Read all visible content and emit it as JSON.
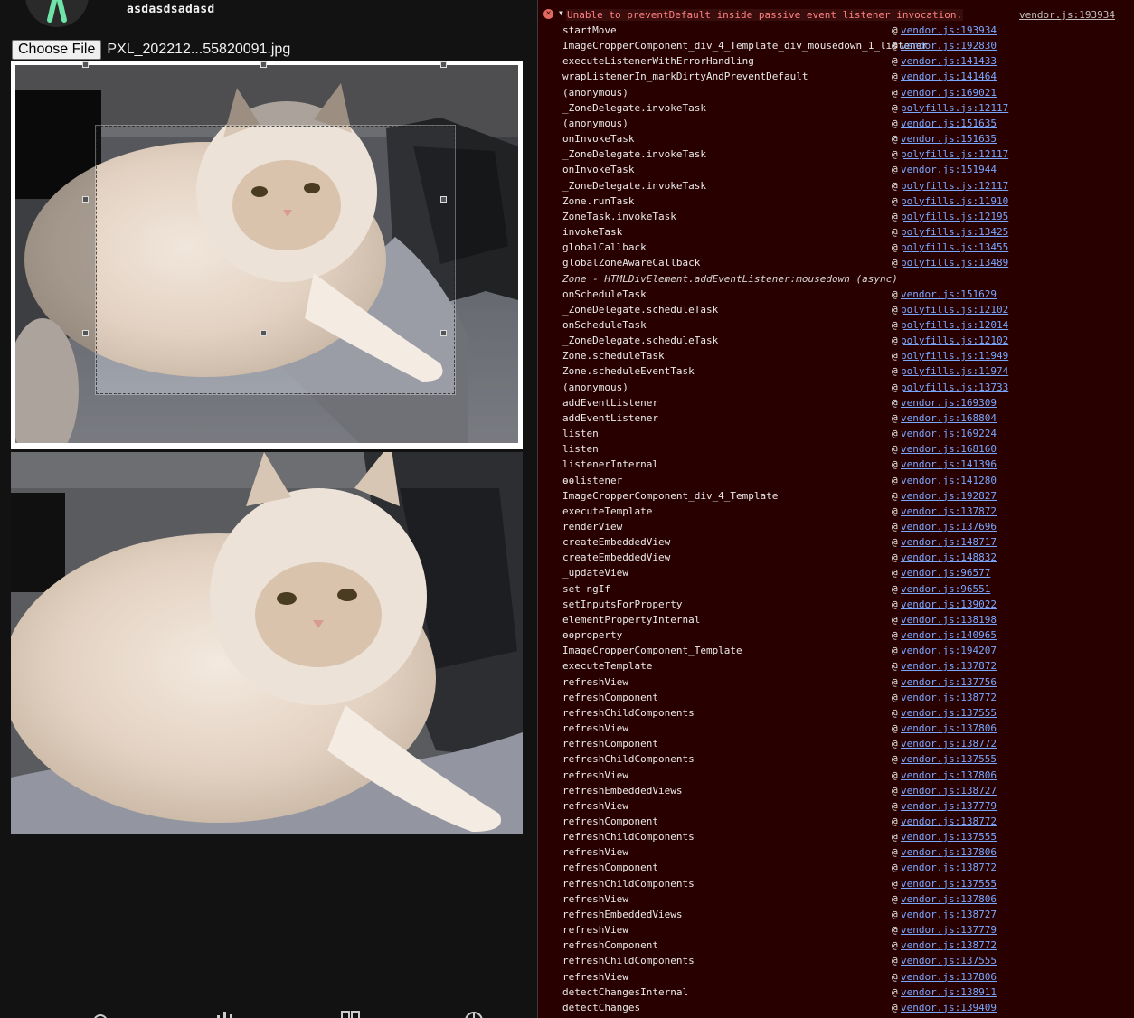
{
  "app": {
    "username": "asdasdsadasd",
    "file_input": {
      "button_label": "Choose File",
      "file_name": "PXL_202212...55820091.jpg"
    },
    "icons": [
      "avatar-logo-icon",
      "menu-icon",
      "search-icon",
      "chart-icon",
      "grid-icon",
      "globe-icon"
    ]
  },
  "console": {
    "error": {
      "message": "Unable to preventDefault inside passive event listener invocation.",
      "source": "vendor.js:193934"
    },
    "stack": [
      {
        "fn": "startMove",
        "loc": "vendor.js:193934"
      },
      {
        "fn": "ImageCropperComponent_div_4_Template_div_mousedown_1_listener",
        "loc": "vendor.js:192830"
      },
      {
        "fn": "executeListenerWithErrorHandling",
        "loc": "vendor.js:141433"
      },
      {
        "fn": "wrapListenerIn_markDirtyAndPreventDefault",
        "loc": "vendor.js:141464"
      },
      {
        "fn": "(anonymous)",
        "loc": "vendor.js:169021"
      },
      {
        "fn": "_ZoneDelegate.invokeTask",
        "loc": "polyfills.js:12117"
      },
      {
        "fn": "(anonymous)",
        "loc": "vendor.js:151635"
      },
      {
        "fn": "onInvokeTask",
        "loc": "vendor.js:151635"
      },
      {
        "fn": "_ZoneDelegate.invokeTask",
        "loc": "polyfills.js:12117"
      },
      {
        "fn": "onInvokeTask",
        "loc": "vendor.js:151944"
      },
      {
        "fn": "_ZoneDelegate.invokeTask",
        "loc": "polyfills.js:12117"
      },
      {
        "fn": "Zone.runTask",
        "loc": "polyfills.js:11910"
      },
      {
        "fn": "ZoneTask.invokeTask",
        "loc": "polyfills.js:12195"
      },
      {
        "fn": "invokeTask",
        "loc": "polyfills.js:13425"
      },
      {
        "fn": "globalCallback",
        "loc": "polyfills.js:13455"
      },
      {
        "fn": "globalZoneAwareCallback",
        "loc": "polyfills.js:13489"
      },
      {
        "fn": "Zone - HTMLDivElement.addEventListener:mousedown (async)",
        "loc": "",
        "async": true
      },
      {
        "fn": "onScheduleTask",
        "loc": "vendor.js:151629"
      },
      {
        "fn": "_ZoneDelegate.scheduleTask",
        "loc": "polyfills.js:12102"
      },
      {
        "fn": "onScheduleTask",
        "loc": "polyfills.js:12014"
      },
      {
        "fn": "_ZoneDelegate.scheduleTask",
        "loc": "polyfills.js:12102"
      },
      {
        "fn": "Zone.scheduleTask",
        "loc": "polyfills.js:11949"
      },
      {
        "fn": "Zone.scheduleEventTask",
        "loc": "polyfills.js:11974"
      },
      {
        "fn": "(anonymous)",
        "loc": "polyfills.js:13733"
      },
      {
        "fn": "addEventListener",
        "loc": "vendor.js:169309"
      },
      {
        "fn": "addEventListener",
        "loc": "vendor.js:168804"
      },
      {
        "fn": "listen",
        "loc": "vendor.js:169224"
      },
      {
        "fn": "listen",
        "loc": "vendor.js:168160"
      },
      {
        "fn": "listenerInternal",
        "loc": "vendor.js:141396"
      },
      {
        "fn": "ɵɵlistener",
        "loc": "vendor.js:141280"
      },
      {
        "fn": "ImageCropperComponent_div_4_Template",
        "loc": "vendor.js:192827"
      },
      {
        "fn": "executeTemplate",
        "loc": "vendor.js:137872"
      },
      {
        "fn": "renderView",
        "loc": "vendor.js:137696"
      },
      {
        "fn": "createEmbeddedView",
        "loc": "vendor.js:148717"
      },
      {
        "fn": "createEmbeddedView",
        "loc": "vendor.js:148832"
      },
      {
        "fn": "_updateView",
        "loc": "vendor.js:96577"
      },
      {
        "fn": "set ngIf",
        "loc": "vendor.js:96551"
      },
      {
        "fn": "setInputsForProperty",
        "loc": "vendor.js:139022"
      },
      {
        "fn": "elementPropertyInternal",
        "loc": "vendor.js:138198"
      },
      {
        "fn": "ɵɵproperty",
        "loc": "vendor.js:140965"
      },
      {
        "fn": "ImageCropperComponent_Template",
        "loc": "vendor.js:194207"
      },
      {
        "fn": "executeTemplate",
        "loc": "vendor.js:137872"
      },
      {
        "fn": "refreshView",
        "loc": "vendor.js:137756"
      },
      {
        "fn": "refreshComponent",
        "loc": "vendor.js:138772"
      },
      {
        "fn": "refreshChildComponents",
        "loc": "vendor.js:137555"
      },
      {
        "fn": "refreshView",
        "loc": "vendor.js:137806"
      },
      {
        "fn": "refreshComponent",
        "loc": "vendor.js:138772"
      },
      {
        "fn": "refreshChildComponents",
        "loc": "vendor.js:137555"
      },
      {
        "fn": "refreshView",
        "loc": "vendor.js:137806"
      },
      {
        "fn": "refreshEmbeddedViews",
        "loc": "vendor.js:138727"
      },
      {
        "fn": "refreshView",
        "loc": "vendor.js:137779"
      },
      {
        "fn": "refreshComponent",
        "loc": "vendor.js:138772"
      },
      {
        "fn": "refreshChildComponents",
        "loc": "vendor.js:137555"
      },
      {
        "fn": "refreshView",
        "loc": "vendor.js:137806"
      },
      {
        "fn": "refreshComponent",
        "loc": "vendor.js:138772"
      },
      {
        "fn": "refreshChildComponents",
        "loc": "vendor.js:137555"
      },
      {
        "fn": "refreshView",
        "loc": "vendor.js:137806"
      },
      {
        "fn": "refreshEmbeddedViews",
        "loc": "vendor.js:138727"
      },
      {
        "fn": "refreshView",
        "loc": "vendor.js:137779"
      },
      {
        "fn": "refreshComponent",
        "loc": "vendor.js:138772"
      },
      {
        "fn": "refreshChildComponents",
        "loc": "vendor.js:137555"
      },
      {
        "fn": "refreshView",
        "loc": "vendor.js:137806"
      },
      {
        "fn": "detectChangesInternal",
        "loc": "vendor.js:138911"
      },
      {
        "fn": "detectChanges",
        "loc": "vendor.js:139409"
      }
    ]
  }
}
